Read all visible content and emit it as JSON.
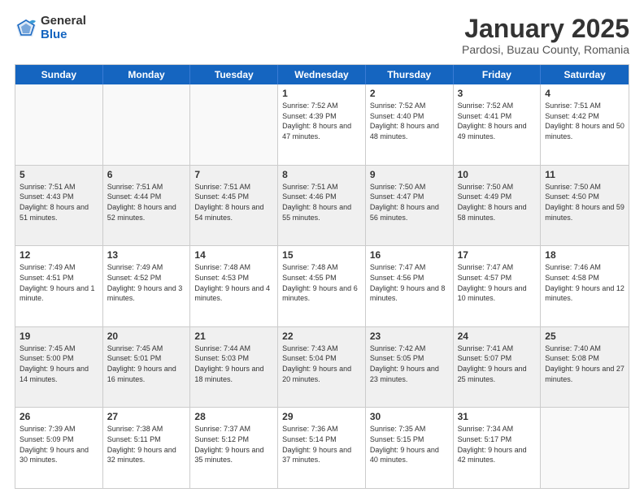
{
  "logo": {
    "general": "General",
    "blue": "Blue"
  },
  "title": "January 2025",
  "location": "Pardosi, Buzau County, Romania",
  "days": [
    "Sunday",
    "Monday",
    "Tuesday",
    "Wednesday",
    "Thursday",
    "Friday",
    "Saturday"
  ],
  "weeks": [
    [
      {
        "day": "",
        "data": ""
      },
      {
        "day": "",
        "data": ""
      },
      {
        "day": "",
        "data": ""
      },
      {
        "day": "1",
        "data": "Sunrise: 7:52 AM\nSunset: 4:39 PM\nDaylight: 8 hours and 47 minutes."
      },
      {
        "day": "2",
        "data": "Sunrise: 7:52 AM\nSunset: 4:40 PM\nDaylight: 8 hours and 48 minutes."
      },
      {
        "day": "3",
        "data": "Sunrise: 7:52 AM\nSunset: 4:41 PM\nDaylight: 8 hours and 49 minutes."
      },
      {
        "day": "4",
        "data": "Sunrise: 7:51 AM\nSunset: 4:42 PM\nDaylight: 8 hours and 50 minutes."
      }
    ],
    [
      {
        "day": "5",
        "data": "Sunrise: 7:51 AM\nSunset: 4:43 PM\nDaylight: 8 hours and 51 minutes."
      },
      {
        "day": "6",
        "data": "Sunrise: 7:51 AM\nSunset: 4:44 PM\nDaylight: 8 hours and 52 minutes."
      },
      {
        "day": "7",
        "data": "Sunrise: 7:51 AM\nSunset: 4:45 PM\nDaylight: 8 hours and 54 minutes."
      },
      {
        "day": "8",
        "data": "Sunrise: 7:51 AM\nSunset: 4:46 PM\nDaylight: 8 hours and 55 minutes."
      },
      {
        "day": "9",
        "data": "Sunrise: 7:50 AM\nSunset: 4:47 PM\nDaylight: 8 hours and 56 minutes."
      },
      {
        "day": "10",
        "data": "Sunrise: 7:50 AM\nSunset: 4:49 PM\nDaylight: 8 hours and 58 minutes."
      },
      {
        "day": "11",
        "data": "Sunrise: 7:50 AM\nSunset: 4:50 PM\nDaylight: 8 hours and 59 minutes."
      }
    ],
    [
      {
        "day": "12",
        "data": "Sunrise: 7:49 AM\nSunset: 4:51 PM\nDaylight: 9 hours and 1 minute."
      },
      {
        "day": "13",
        "data": "Sunrise: 7:49 AM\nSunset: 4:52 PM\nDaylight: 9 hours and 3 minutes."
      },
      {
        "day": "14",
        "data": "Sunrise: 7:48 AM\nSunset: 4:53 PM\nDaylight: 9 hours and 4 minutes."
      },
      {
        "day": "15",
        "data": "Sunrise: 7:48 AM\nSunset: 4:55 PM\nDaylight: 9 hours and 6 minutes."
      },
      {
        "day": "16",
        "data": "Sunrise: 7:47 AM\nSunset: 4:56 PM\nDaylight: 9 hours and 8 minutes."
      },
      {
        "day": "17",
        "data": "Sunrise: 7:47 AM\nSunset: 4:57 PM\nDaylight: 9 hours and 10 minutes."
      },
      {
        "day": "18",
        "data": "Sunrise: 7:46 AM\nSunset: 4:58 PM\nDaylight: 9 hours and 12 minutes."
      }
    ],
    [
      {
        "day": "19",
        "data": "Sunrise: 7:45 AM\nSunset: 5:00 PM\nDaylight: 9 hours and 14 minutes."
      },
      {
        "day": "20",
        "data": "Sunrise: 7:45 AM\nSunset: 5:01 PM\nDaylight: 9 hours and 16 minutes."
      },
      {
        "day": "21",
        "data": "Sunrise: 7:44 AM\nSunset: 5:03 PM\nDaylight: 9 hours and 18 minutes."
      },
      {
        "day": "22",
        "data": "Sunrise: 7:43 AM\nSunset: 5:04 PM\nDaylight: 9 hours and 20 minutes."
      },
      {
        "day": "23",
        "data": "Sunrise: 7:42 AM\nSunset: 5:05 PM\nDaylight: 9 hours and 23 minutes."
      },
      {
        "day": "24",
        "data": "Sunrise: 7:41 AM\nSunset: 5:07 PM\nDaylight: 9 hours and 25 minutes."
      },
      {
        "day": "25",
        "data": "Sunrise: 7:40 AM\nSunset: 5:08 PM\nDaylight: 9 hours and 27 minutes."
      }
    ],
    [
      {
        "day": "26",
        "data": "Sunrise: 7:39 AM\nSunset: 5:09 PM\nDaylight: 9 hours and 30 minutes."
      },
      {
        "day": "27",
        "data": "Sunrise: 7:38 AM\nSunset: 5:11 PM\nDaylight: 9 hours and 32 minutes."
      },
      {
        "day": "28",
        "data": "Sunrise: 7:37 AM\nSunset: 5:12 PM\nDaylight: 9 hours and 35 minutes."
      },
      {
        "day": "29",
        "data": "Sunrise: 7:36 AM\nSunset: 5:14 PM\nDaylight: 9 hours and 37 minutes."
      },
      {
        "day": "30",
        "data": "Sunrise: 7:35 AM\nSunset: 5:15 PM\nDaylight: 9 hours and 40 minutes."
      },
      {
        "day": "31",
        "data": "Sunrise: 7:34 AM\nSunset: 5:17 PM\nDaylight: 9 hours and 42 minutes."
      },
      {
        "day": "",
        "data": ""
      }
    ]
  ]
}
